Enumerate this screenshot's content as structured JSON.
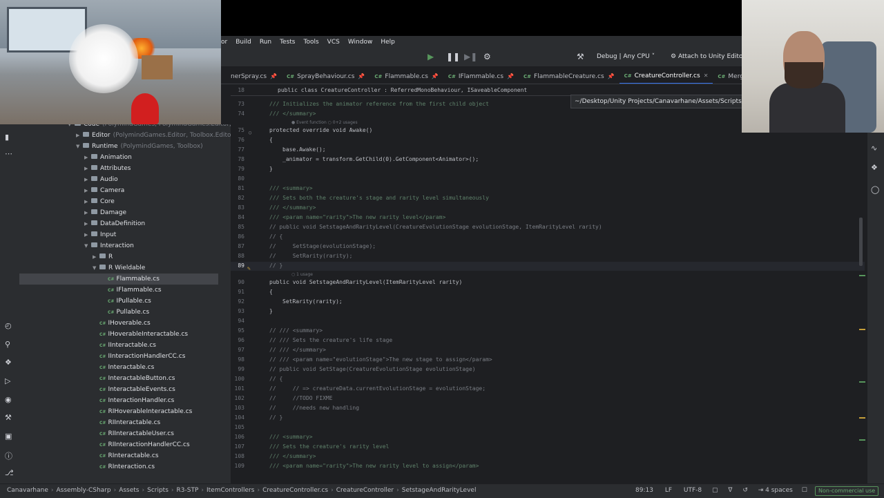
{
  "menu": [
    "Build",
    "Run",
    "Tests",
    "Tools",
    "VCS",
    "Window",
    "Help"
  ],
  "menu_partial": "or",
  "toolbar": {
    "config": "Debug | Any CPU",
    "attach": "Attach to Unity Editor"
  },
  "tabs": [
    {
      "label": "nerSpray.cs",
      "active": false
    },
    {
      "label": "SprayBehaviour.cs",
      "active": false
    },
    {
      "label": "Flammable.cs",
      "active": false
    },
    {
      "label": "IFlammable.cs",
      "active": false
    },
    {
      "label": "FlammableCreature.cs",
      "active": false
    },
    {
      "label": "CreatureController.cs",
      "active": true
    },
    {
      "label": "MergeMachine",
      "active": false
    }
  ],
  "tooltip": "~/Desktop/Unity Projects/Canavarhane/Assets/Scripts/",
  "tree": [
    {
      "label": "Code",
      "dim": "(PolymindGames, PolymindGames.Editor, Toolbox.Editor",
      "level": 0,
      "type": "folder",
      "open": true
    },
    {
      "label": "Editor",
      "dim": "(PolymindGames.Editor, Toolbox.Editor)",
      "level": 1,
      "type": "folder",
      "open": false
    },
    {
      "label": "Runtime",
      "dim": "(PolymindGames, Toolbox)",
      "level": 1,
      "type": "folder",
      "open": true
    },
    {
      "label": "Animation",
      "dim": "",
      "level": 2,
      "type": "folder",
      "open": false
    },
    {
      "label": "Attributes",
      "dim": "",
      "level": 2,
      "type": "folder",
      "open": false
    },
    {
      "label": "Audio",
      "dim": "",
      "level": 2,
      "type": "folder",
      "open": false
    },
    {
      "label": "Camera",
      "dim": "",
      "level": 2,
      "type": "folder",
      "open": false
    },
    {
      "label": "Core",
      "dim": "",
      "level": 2,
      "type": "folder",
      "open": false
    },
    {
      "label": "Damage",
      "dim": "",
      "level": 2,
      "type": "folder",
      "open": false
    },
    {
      "label": "DataDefinition",
      "dim": "",
      "level": 2,
      "type": "folder",
      "open": false
    },
    {
      "label": "Input",
      "dim": "",
      "level": 2,
      "type": "folder",
      "open": false
    },
    {
      "label": "Interaction",
      "dim": "",
      "level": 2,
      "type": "folder",
      "open": true
    },
    {
      "label": "R",
      "dim": "",
      "level": 3,
      "type": "folder",
      "open": false
    },
    {
      "label": "R Wieldable",
      "dim": "",
      "level": 3,
      "type": "folder",
      "open": true
    },
    {
      "label": "Flammable.cs",
      "dim": "",
      "level": 4,
      "type": "file",
      "selected": true
    },
    {
      "label": "IFlammable.cs",
      "dim": "",
      "level": 4,
      "type": "file"
    },
    {
      "label": "IPullable.cs",
      "dim": "",
      "level": 4,
      "type": "file"
    },
    {
      "label": "Pullable.cs",
      "dim": "",
      "level": 4,
      "type": "file"
    },
    {
      "label": "IHoverable.cs",
      "dim": "",
      "level": 3,
      "type": "file"
    },
    {
      "label": "IHoverableInteractable.cs",
      "dim": "",
      "level": 3,
      "type": "file"
    },
    {
      "label": "IInteractable.cs",
      "dim": "",
      "level": 3,
      "type": "file"
    },
    {
      "label": "IInteractionHandlerCC.cs",
      "dim": "",
      "level": 3,
      "type": "file"
    },
    {
      "label": "Interactable.cs",
      "dim": "",
      "level": 3,
      "type": "file"
    },
    {
      "label": "InteractableButton.cs",
      "dim": "",
      "level": 3,
      "type": "file"
    },
    {
      "label": "InteractableEvents.cs",
      "dim": "",
      "level": 3,
      "type": "file"
    },
    {
      "label": "InteractionHandler.cs",
      "dim": "",
      "level": 3,
      "type": "file"
    },
    {
      "label": "RIHoverableInteractable.cs",
      "dim": "",
      "level": 3,
      "type": "file"
    },
    {
      "label": "RIInteractable.cs",
      "dim": "",
      "level": 3,
      "type": "file"
    },
    {
      "label": "RIInteractableUser.cs",
      "dim": "",
      "level": 3,
      "type": "file"
    },
    {
      "label": "RIInteractionHandlerCC.cs",
      "dim": "",
      "level": 3,
      "type": "file"
    },
    {
      "label": "RInteractable.cs",
      "dim": "",
      "level": 3,
      "type": "file"
    },
    {
      "label": "RInteraction.cs",
      "dim": "",
      "level": 3,
      "type": "file"
    }
  ],
  "editor": {
    "sticky": {
      "num": "18",
      "text": "public class CreatureController : ReferredMonoBehaviour, ISaveableComponent"
    },
    "lines": [
      {
        "num": "73",
        "text": "/// Initializes the animator reference from the first child object",
        "kind": "doc",
        "indent": 2
      },
      {
        "num": "74",
        "text": "/// </summary>",
        "kind": "doc",
        "indent": 2
      },
      {
        "num": "",
        "text": "● Event function   ○ 0+2 usages",
        "kind": "hint",
        "indent": 2
      },
      {
        "num": "75",
        "text": "protected override void Awake()",
        "kind": "code",
        "indent": 2
      },
      {
        "num": "76",
        "text": "{",
        "kind": "code",
        "indent": 2
      },
      {
        "num": "77",
        "text": "base.Awake();",
        "kind": "code",
        "indent": 3
      },
      {
        "num": "78",
        "text": "_animator = transform.GetChild(0).GetComponent<Animator>();",
        "kind": "code",
        "indent": 3
      },
      {
        "num": "79",
        "text": "}",
        "kind": "code",
        "indent": 2
      },
      {
        "num": "80",
        "text": "",
        "kind": "code",
        "indent": 2
      },
      {
        "num": "81",
        "text": "/// <summary>",
        "kind": "doc",
        "indent": 2
      },
      {
        "num": "82",
        "text": "/// Sets both the creature's stage and rarity level simultaneously",
        "kind": "doc",
        "indent": 2
      },
      {
        "num": "83",
        "text": "/// </summary>",
        "kind": "doc",
        "indent": 2
      },
      {
        "num": "84",
        "text": "/// <param name=\"rarity\">The new rarity level</param>",
        "kind": "doc",
        "indent": 2
      },
      {
        "num": "85",
        "text": "// public void SetstageAndRarityLevel(CreatureEvolutionStage evolutionStage, ItemRarityLevel rarity)",
        "kind": "comment",
        "indent": 2
      },
      {
        "num": "86",
        "text": "// {",
        "kind": "comment",
        "indent": 2
      },
      {
        "num": "87",
        "text": "//     SetStage(evolutionStage);",
        "kind": "comment",
        "indent": 2
      },
      {
        "num": "88",
        "text": "//     SetRarity(rarity);",
        "kind": "comment",
        "indent": 2
      },
      {
        "num": "89",
        "text": "// }",
        "kind": "comment",
        "indent": 2,
        "current": true
      },
      {
        "num": "",
        "text": "○ 1 usage",
        "kind": "hint",
        "indent": 2
      },
      {
        "num": "90",
        "text": "public void SetstageAndRarityLevel(ItemRarityLevel rarity)",
        "kind": "code",
        "indent": 2
      },
      {
        "num": "91",
        "text": "{",
        "kind": "code",
        "indent": 2
      },
      {
        "num": "92",
        "text": "SetRarity(rarity);",
        "kind": "code",
        "indent": 3
      },
      {
        "num": "93",
        "text": "}",
        "kind": "code",
        "indent": 2
      },
      {
        "num": "94",
        "text": "",
        "kind": "code",
        "indent": 2
      },
      {
        "num": "95",
        "text": "// /// <summary>",
        "kind": "comment",
        "indent": 2
      },
      {
        "num": "96",
        "text": "// /// Sets the creature's life stage",
        "kind": "comment",
        "indent": 2
      },
      {
        "num": "97",
        "text": "// /// </summary>",
        "kind": "comment",
        "indent": 2
      },
      {
        "num": "98",
        "text": "// /// <param name=\"evolutionStage\">The new stage to assign</param>",
        "kind": "comment",
        "indent": 2
      },
      {
        "num": "99",
        "text": "// public void SetStage(CreatureEvolutionStage evolutionStage)",
        "kind": "comment",
        "indent": 2
      },
      {
        "num": "100",
        "text": "// {",
        "kind": "comment",
        "indent": 2
      },
      {
        "num": "101",
        "text": "//     // => creatureData.currentEvolutionStage = evolutionStage;",
        "kind": "comment",
        "indent": 2
      },
      {
        "num": "102",
        "text": "//     //TODO FIXME",
        "kind": "comment",
        "indent": 2
      },
      {
        "num": "103",
        "text": "//     //needs new handling",
        "kind": "comment",
        "indent": 2
      },
      {
        "num": "104",
        "text": "// }",
        "kind": "comment",
        "indent": 2
      },
      {
        "num": "105",
        "text": "",
        "kind": "code",
        "indent": 2
      },
      {
        "num": "106",
        "text": "/// <summary>",
        "kind": "doc",
        "indent": 2
      },
      {
        "num": "107",
        "text": "/// Sets the creature's rarity level",
        "kind": "doc",
        "indent": 2
      },
      {
        "num": "108",
        "text": "/// </summary>",
        "kind": "doc",
        "indent": 2
      },
      {
        "num": "109",
        "text": "/// <param name=\"rarity\">The new rarity level to assign</param>",
        "kind": "doc",
        "indent": 2
      }
    ]
  },
  "breadcrumbs": [
    "Canavarhane",
    "Assembly-CSharp",
    "Assets",
    "Scripts",
    "R3-STP",
    "ItemControllers",
    "CreatureController.cs",
    "CreatureController",
    "SetstageAndRarityLevel"
  ],
  "status": {
    "position": "89:13",
    "line_ending": "LF",
    "encoding": "UTF-8",
    "indent": "4 spaces",
    "license": "Non-commercial use"
  },
  "colors": {
    "accent": "#3574f0",
    "background": "#1e1f22",
    "panel": "#2b2d30"
  }
}
